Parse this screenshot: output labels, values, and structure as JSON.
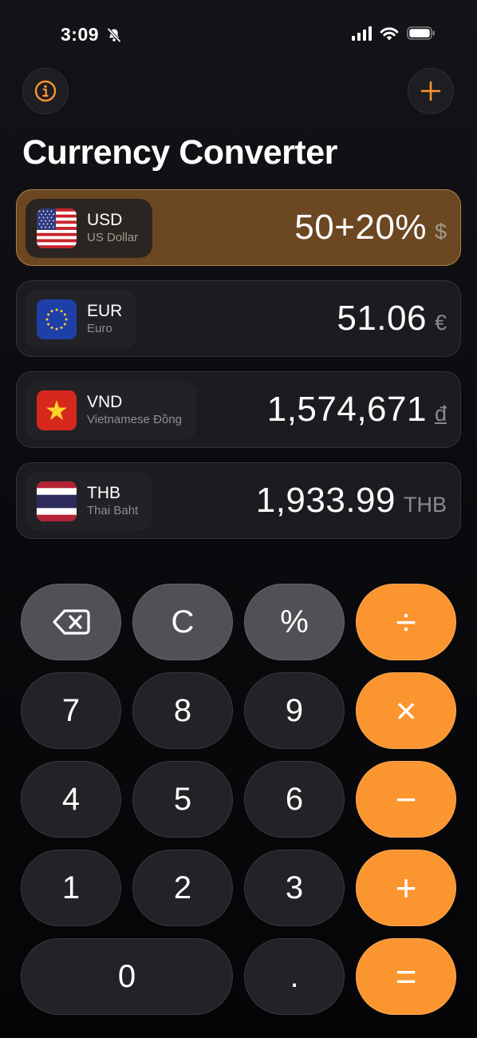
{
  "status_bar": {
    "time": "3:09"
  },
  "header": {
    "title": "Currency Converter"
  },
  "icons": {
    "info": "info-icon",
    "add": "plus-icon",
    "backspace": "backspace-icon",
    "silent": "bell-slash-icon"
  },
  "colors": {
    "accent": "#fb9530",
    "active_card": "#6b4722",
    "background": "#0b0b0f"
  },
  "currencies": [
    {
      "code": "USD",
      "name": "US Dollar",
      "amount": "50+20%",
      "symbol": "$",
      "active": true
    },
    {
      "code": "EUR",
      "name": "Euro",
      "amount": "51.06",
      "symbol": "€",
      "active": false
    },
    {
      "code": "VND",
      "name": "Vietnamese Đồng",
      "amount": "1,574,671",
      "symbol": "đ",
      "active": false
    },
    {
      "code": "THB",
      "name": "Thai Baht",
      "amount": "1,933.99",
      "symbol": "THB",
      "active": false
    }
  ],
  "keypad": {
    "clear": "C",
    "percent": "%",
    "divide": "÷",
    "multiply": "×",
    "minus": "−",
    "plus": "+",
    "equals": "=",
    "seven": "7",
    "eight": "8",
    "nine": "9",
    "four": "4",
    "five": "5",
    "six": "6",
    "one": "1",
    "two": "2",
    "three": "3",
    "zero": "0",
    "decimal": "."
  }
}
